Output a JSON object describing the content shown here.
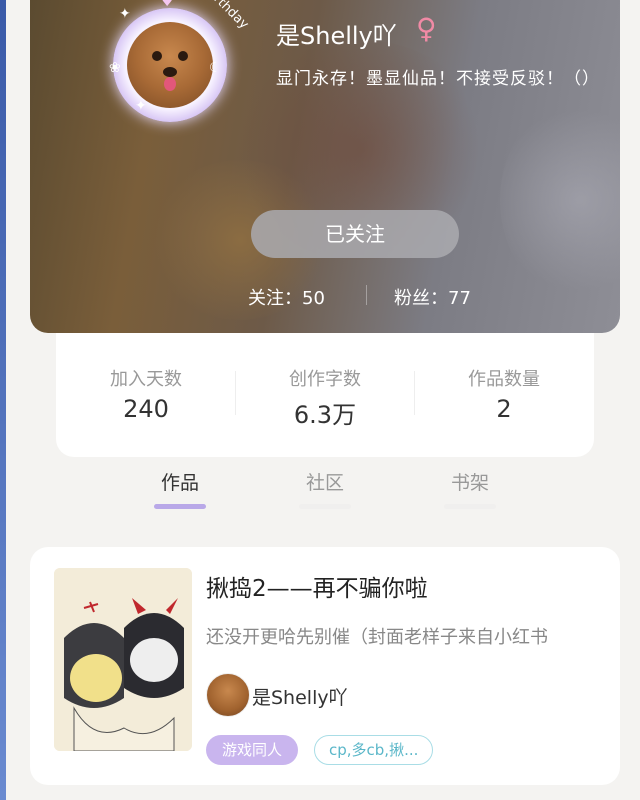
{
  "profile": {
    "username": "是Shelly吖",
    "gender_symbol": "♀",
    "bio": "显门永存！墨显仙品！不接受反驳！（）",
    "follow_button": "已关注",
    "following": "关注：50",
    "fans": "粉丝：77",
    "avatar_text": "Birthday"
  },
  "stats": [
    {
      "label": "加入天数",
      "value": "240"
    },
    {
      "label": "创作字数",
      "value": "6.3万"
    },
    {
      "label": "作品数量",
      "value": "2"
    }
  ],
  "tabs": [
    {
      "label": "作品",
      "active": true
    },
    {
      "label": "社区",
      "active": false
    },
    {
      "label": "书架",
      "active": false
    }
  ],
  "work": {
    "title": "揪捣2——再不骗你啦",
    "description": "还没开更哈先别催（封面老样子来自小红书",
    "author": "是Shelly吖",
    "tags": [
      "游戏同人",
      "cp,多cb,揪..."
    ]
  },
  "colors": {
    "accent": "#b9a8e8",
    "tag_fill": "#c9b5ee",
    "tag_outline": "#a9dde6",
    "gender": "#f08aa5"
  }
}
